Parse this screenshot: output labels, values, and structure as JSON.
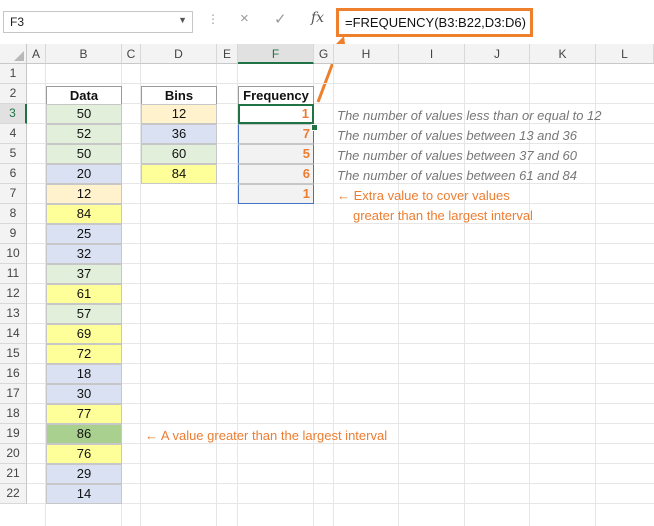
{
  "formula_bar": {
    "name_box": "F3",
    "cancel_icon": "×",
    "enter_icon": "✓",
    "fx_label": "fx",
    "formula": "=FREQUENCY(B3:B22,D3:D6)"
  },
  "columns": [
    "A",
    "B",
    "C",
    "D",
    "E",
    "F",
    "G",
    "H",
    "I",
    "J",
    "K",
    "L"
  ],
  "rows": [
    "1",
    "2",
    "3",
    "4",
    "5",
    "6",
    "7",
    "8",
    "9",
    "10",
    "11",
    "12",
    "13",
    "14",
    "15",
    "16",
    "17",
    "18",
    "19",
    "20",
    "21",
    "22"
  ],
  "data_header": "Data",
  "bins_header": "Bins",
  "freq_header": "Frequency",
  "data_values": [
    {
      "value": "50",
      "color": "green"
    },
    {
      "value": "52",
      "color": "green"
    },
    {
      "value": "50",
      "color": "green"
    },
    {
      "value": "20",
      "color": "blue"
    },
    {
      "value": "12",
      "color": "orange"
    },
    {
      "value": "84",
      "color": "yellow"
    },
    {
      "value": "25",
      "color": "blue"
    },
    {
      "value": "32",
      "color": "blue"
    },
    {
      "value": "37",
      "color": "green"
    },
    {
      "value": "61",
      "color": "yellow"
    },
    {
      "value": "57",
      "color": "green"
    },
    {
      "value": "69",
      "color": "yellow"
    },
    {
      "value": "72",
      "color": "yellow"
    },
    {
      "value": "18",
      "color": "blue"
    },
    {
      "value": "30",
      "color": "blue"
    },
    {
      "value": "77",
      "color": "yellow"
    },
    {
      "value": "86",
      "color": "dkgreen"
    },
    {
      "value": "76",
      "color": "yellow"
    },
    {
      "value": "29",
      "color": "blue"
    },
    {
      "value": "14",
      "color": "blue"
    }
  ],
  "bins": [
    {
      "value": "12",
      "color": "orange"
    },
    {
      "value": "36",
      "color": "blue"
    },
    {
      "value": "60",
      "color": "green"
    },
    {
      "value": "84",
      "color": "yellow"
    }
  ],
  "frequency": [
    "1",
    "7",
    "5",
    "6",
    "1"
  ],
  "notes": [
    "The number of values less than or equal to 12",
    "The number of values between 13 and 36",
    "The number of values between 37 and 60",
    "The number of values between 61 and 84"
  ],
  "extra_note_line1": "← Extra value to cover values",
  "extra_note_line2": "greater than the largest interval",
  "value_note": "← A value greater than the largest interval",
  "colors": {
    "accent_orange": "#ed7d31",
    "formula_highlight": "#ee7f2d",
    "selection_green": "#217346"
  }
}
